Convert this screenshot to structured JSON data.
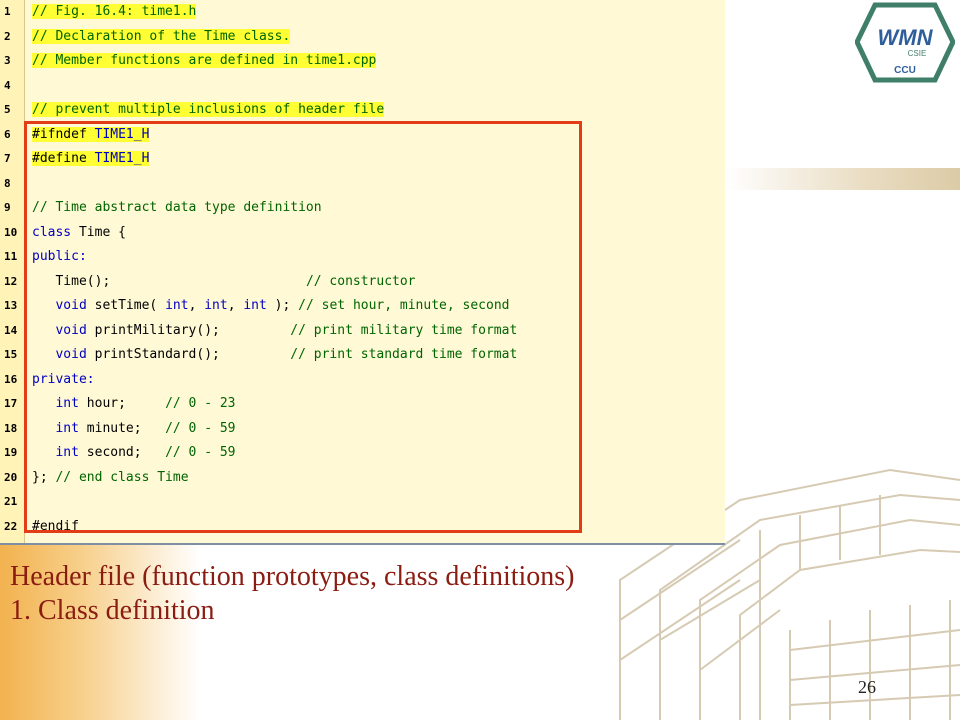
{
  "code": {
    "lines": [
      {
        "num": "1",
        "segments": [
          {
            "t": "// Fig. 16.4: ",
            "c": "comment",
            "hl": true
          },
          {
            "t": "time1.h",
            "c": "comment",
            "hl": true
          }
        ]
      },
      {
        "num": "2",
        "segments": [
          {
            "t": "// Declaration of the Time class.",
            "c": "comment",
            "hl": true
          }
        ]
      },
      {
        "num": "3",
        "segments": [
          {
            "t": "// Member functions are defined in time1.cpp",
            "c": "comment",
            "hl": true
          }
        ]
      },
      {
        "num": "4",
        "segments": []
      },
      {
        "num": "5",
        "segments": [
          {
            "t": "// prevent multiple inclusions of header file",
            "c": "comment",
            "hl": true
          }
        ]
      },
      {
        "num": "6",
        "segments": [
          {
            "t": "#ifndef",
            "c": "plain",
            "hl": true
          },
          {
            "t": " TIME1_H",
            "c": "key",
            "hl": true
          }
        ]
      },
      {
        "num": "7",
        "segments": [
          {
            "t": "#define",
            "c": "plain",
            "hl": true
          },
          {
            "t": " TIME1_H",
            "c": "key",
            "hl": true
          }
        ]
      },
      {
        "num": "8",
        "segments": []
      },
      {
        "num": "9",
        "segments": [
          {
            "t": "// Time abstract data type definition",
            "c": "comment",
            "hl": false
          }
        ]
      },
      {
        "num": "10",
        "segments": [
          {
            "t": "class",
            "c": "key",
            "hl": false
          },
          {
            "t": " Time {",
            "c": "plain",
            "hl": false
          }
        ]
      },
      {
        "num": "11",
        "segments": [
          {
            "t": "public:",
            "c": "key",
            "hl": false
          }
        ]
      },
      {
        "num": "12",
        "segments": [
          {
            "t": "   Time();                         ",
            "c": "plain",
            "hl": false
          },
          {
            "t": "// constructor",
            "c": "comment",
            "hl": false
          }
        ]
      },
      {
        "num": "13",
        "segments": [
          {
            "t": "   ",
            "c": "plain",
            "hl": false
          },
          {
            "t": "void",
            "c": "key",
            "hl": false
          },
          {
            "t": " setTime( ",
            "c": "plain",
            "hl": false
          },
          {
            "t": "int",
            "c": "key",
            "hl": false
          },
          {
            "t": ", ",
            "c": "plain",
            "hl": false
          },
          {
            "t": "int",
            "c": "key",
            "hl": false
          },
          {
            "t": ", ",
            "c": "plain",
            "hl": false
          },
          {
            "t": "int",
            "c": "key",
            "hl": false
          },
          {
            "t": " ); ",
            "c": "plain",
            "hl": false
          },
          {
            "t": "// set hour, minute, second",
            "c": "comment",
            "hl": false
          }
        ]
      },
      {
        "num": "14",
        "segments": [
          {
            "t": "   ",
            "c": "plain",
            "hl": false
          },
          {
            "t": "void",
            "c": "key",
            "hl": false
          },
          {
            "t": " printMilitary();         ",
            "c": "plain",
            "hl": false
          },
          {
            "t": "// print military time format",
            "c": "comment",
            "hl": false
          }
        ]
      },
      {
        "num": "15",
        "segments": [
          {
            "t": "   ",
            "c": "plain",
            "hl": false
          },
          {
            "t": "void",
            "c": "key",
            "hl": false
          },
          {
            "t": " printStandard();         ",
            "c": "plain",
            "hl": false
          },
          {
            "t": "// print standard time format",
            "c": "comment",
            "hl": false
          }
        ]
      },
      {
        "num": "16",
        "segments": [
          {
            "t": "private:",
            "c": "key",
            "hl": false
          }
        ]
      },
      {
        "num": "17",
        "segments": [
          {
            "t": "   ",
            "c": "plain",
            "hl": false
          },
          {
            "t": "int",
            "c": "key",
            "hl": false
          },
          {
            "t": " hour;     ",
            "c": "plain",
            "hl": false
          },
          {
            "t": "// 0 - 23",
            "c": "comment",
            "hl": false
          }
        ]
      },
      {
        "num": "18",
        "segments": [
          {
            "t": "   ",
            "c": "plain",
            "hl": false
          },
          {
            "t": "int",
            "c": "key",
            "hl": false
          },
          {
            "t": " minute;   ",
            "c": "plain",
            "hl": false
          },
          {
            "t": "// 0 - 59",
            "c": "comment",
            "hl": false
          }
        ]
      },
      {
        "num": "19",
        "segments": [
          {
            "t": "   ",
            "c": "plain",
            "hl": false
          },
          {
            "t": "int",
            "c": "key",
            "hl": false
          },
          {
            "t": " second;   ",
            "c": "plain",
            "hl": false
          },
          {
            "t": "// 0 - 59",
            "c": "comment",
            "hl": false
          }
        ]
      },
      {
        "num": "20",
        "segments": [
          {
            "t": "}; ",
            "c": "plain",
            "hl": false
          },
          {
            "t": "// end class Time",
            "c": "comment",
            "hl": false
          }
        ]
      },
      {
        "num": "21",
        "segments": []
      },
      {
        "num": "22",
        "segments": [
          {
            "t": "#endif",
            "c": "plain",
            "hl": false
          }
        ]
      }
    ]
  },
  "caption": {
    "line1": "Header file (function prototypes, class definitions)",
    "line2": "1. Class definition"
  },
  "page_number": "26",
  "logo": {
    "text": "WMN",
    "sub1": "CSIE",
    "sub2": "CCU"
  },
  "colors": {
    "highlight_box": "#e23d16",
    "caption": "#8a1c12",
    "comment": "#006400",
    "keyword": "#0000c0"
  }
}
